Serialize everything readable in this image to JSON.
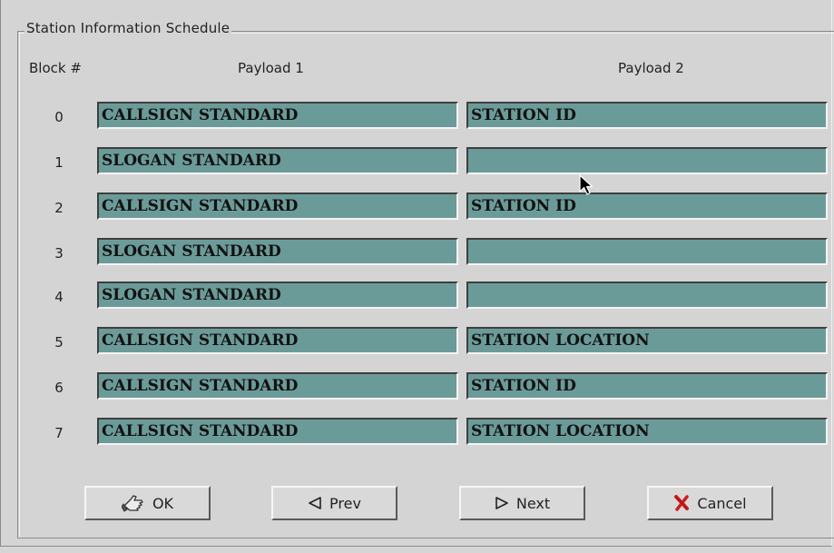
{
  "dialog": {
    "group_title": "Station Information Schedule",
    "headers": {
      "block": "Block #",
      "payload1": "Payload 1",
      "payload2": "Payload 2"
    }
  },
  "rows": [
    {
      "block": "0",
      "payload1": "CALLSIGN STANDARD",
      "payload2": "STATION ID"
    },
    {
      "block": "1",
      "payload1": "SLOGAN STANDARD",
      "payload2": ""
    },
    {
      "block": "2",
      "payload1": "CALLSIGN STANDARD",
      "payload2": "STATION ID"
    },
    {
      "block": "3",
      "payload1": "SLOGAN STANDARD",
      "payload2": ""
    },
    {
      "block": "4",
      "payload1": "SLOGAN STANDARD",
      "payload2": ""
    },
    {
      "block": "5",
      "payload1": "CALLSIGN STANDARD",
      "payload2": "STATION LOCATION"
    },
    {
      "block": "6",
      "payload1": "CALLSIGN STANDARD",
      "payload2": "STATION ID"
    },
    {
      "block": "7",
      "payload1": "CALLSIGN STANDARD",
      "payload2": "STATION LOCATION"
    }
  ],
  "buttons": {
    "ok": {
      "label": "OK",
      "icon": "ok-hand-icon"
    },
    "prev": {
      "label": "Prev",
      "icon": "left-arrow-icon"
    },
    "next": {
      "label": "Next",
      "icon": "right-arrow-icon"
    },
    "cancel": {
      "label": "Cancel",
      "icon": "red-x-icon"
    }
  },
  "colors": {
    "field_bg": "#6b9b99",
    "window_bg": "#d4d4d4",
    "cancel_icon": "#cc1f1f"
  }
}
